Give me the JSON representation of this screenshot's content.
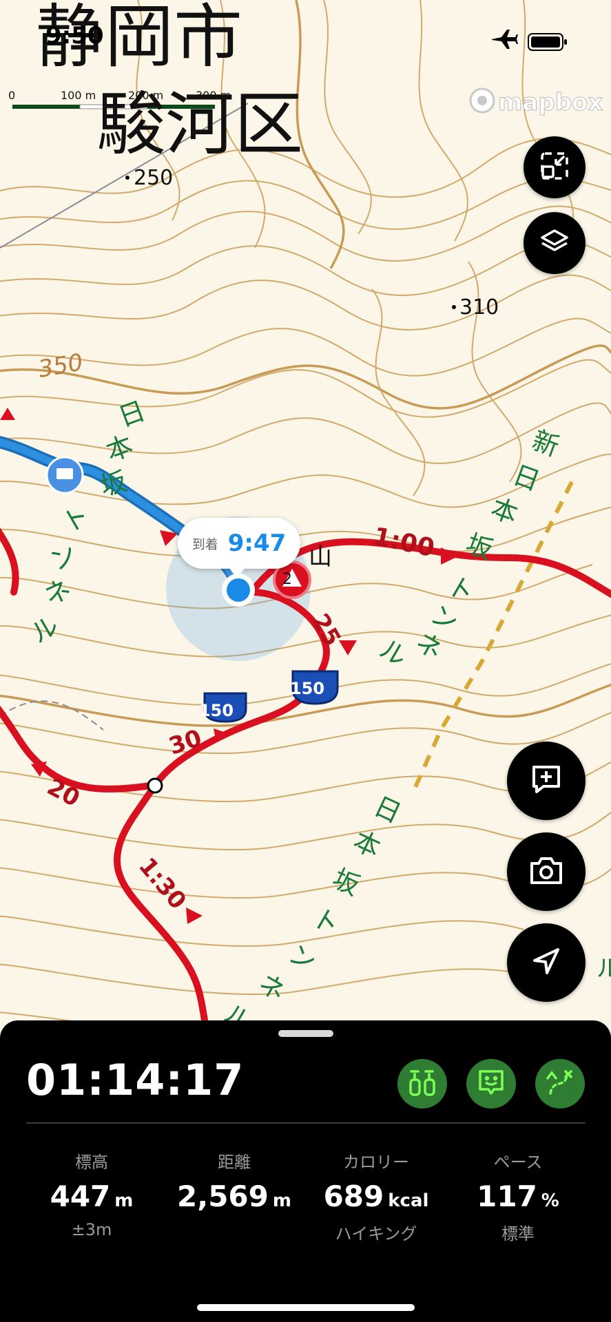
{
  "status_bar": {
    "time": "9:50"
  },
  "map": {
    "attribution": "mapbox",
    "labels": {
      "city": "静岡市",
      "ward": "駿河区",
      "elev_250": "250",
      "elev_310": "310",
      "contour_350": "350",
      "peak_suffix": "山",
      "tunnel_left": [
        "日",
        "本",
        "坂",
        "ト",
        "ン",
        "ネ",
        "ル"
      ],
      "tunnel_right": [
        "新",
        "日",
        "本",
        "坂",
        "ト",
        "ン",
        "ネ",
        "ル"
      ],
      "tunnel_bottom": [
        "日",
        "本",
        "坂",
        "ト",
        "ン",
        "ネ",
        "ル"
      ],
      "route_shield_1": "150",
      "route_shield_2": "150",
      "time_1_00": "1:00",
      "time_25": "25",
      "time_30": "30",
      "time_20": "20",
      "time_1_30": "1:30",
      "right_edge_label": "ル",
      "route_marker": "2"
    },
    "scale_bar": {
      "tick_0": "0",
      "tick_100": "100 m",
      "tick_200": "200 m",
      "tick_300": "300 m"
    },
    "callout": {
      "label": "到着",
      "time": "9:47"
    },
    "colors": {
      "route_red": "#d81020",
      "track_blue": "#2d8fe0",
      "contour": "#d2a96a",
      "green_text": "#1a7a3a"
    }
  },
  "controls": {
    "icons": [
      "collapse-icon",
      "layers-icon",
      "add-note-icon",
      "camera-icon",
      "location-arrow-icon"
    ]
  },
  "bottom_panel": {
    "timer": "01:14:17",
    "action_icons": [
      "gear-icon",
      "face-icon",
      "route-icon"
    ],
    "stats": [
      {
        "label": "標高",
        "value": "447",
        "unit": "m",
        "sub": "±3m"
      },
      {
        "label": "距離",
        "value": "2,569",
        "unit": "m",
        "sub": ""
      },
      {
        "label": "カロリー",
        "value": "689",
        "unit": "kcal",
        "sub": "ハイキング"
      },
      {
        "label": "ペース",
        "value": "117",
        "unit": "%",
        "sub": "標準"
      }
    ]
  }
}
